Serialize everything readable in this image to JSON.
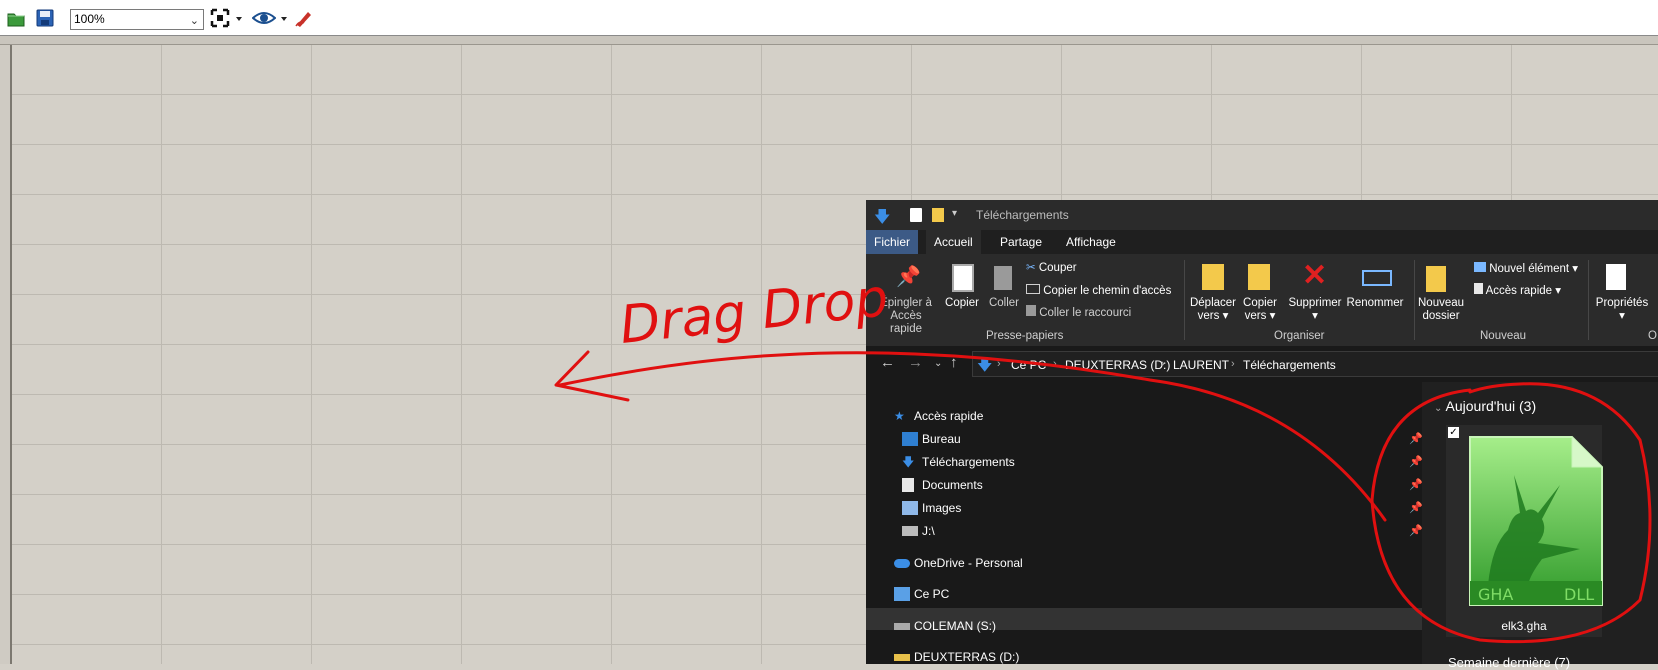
{
  "toolbar": {
    "zoom_value": "100%",
    "icons": [
      "open-file-icon",
      "save-icon",
      "zoom-extents-icon",
      "preview-eye-icon",
      "sketch-pen-icon"
    ]
  },
  "explorer": {
    "title": "Téléchargements",
    "tabs": [
      "Fichier",
      "Accueil",
      "Partage",
      "Affichage"
    ],
    "ribbon": {
      "pin_line1": "Épingler à",
      "pin_line2": "Accès rapide",
      "copy": "Copier",
      "paste": "Coller",
      "cut": "Couper",
      "copy_path": "Copier le chemin d'accès",
      "paste_shortcut": "Coller le raccourci",
      "group_clipboard": "Presse-papiers",
      "move_line1": "Déplacer",
      "move_line2": "vers",
      "copyto_line1": "Copier",
      "copyto_line2": "vers",
      "delete": "Supprimer",
      "rename": "Renommer",
      "group_organize": "Organiser",
      "newfolder_line1": "Nouveau",
      "newfolder_line2": "dossier",
      "new_item": "Nouvel élément",
      "easy_access": "Accès rapide",
      "group_new": "Nouveau",
      "properties": "Propriétés",
      "group_open_partial": "O"
    },
    "breadcrumb": [
      "Ce PC",
      "DEUXTERRAS (D:)",
      "LAURENT",
      "Téléchargements"
    ],
    "nav": {
      "quick_access": "Accès rapide",
      "bureau": "Bureau",
      "telechargements": "Téléchargements",
      "documents": "Documents",
      "images": "Images",
      "j_drive": "J:\\",
      "onedrive": "OneDrive - Personal",
      "ce_pc": "Ce PC",
      "coleman": "COLEMAN (S:)",
      "deuxterras_partial": "DEUXTERRAS (D:)"
    },
    "files": {
      "group_today": "Aujourd'hui (3)",
      "file_name": "elk3.gha",
      "badge_left": "GHA",
      "badge_right": "DLL",
      "next_group_partial": "Semaine dernière (7)"
    }
  },
  "annotation": {
    "text": "Drag Drop",
    "color": "#e01010"
  }
}
